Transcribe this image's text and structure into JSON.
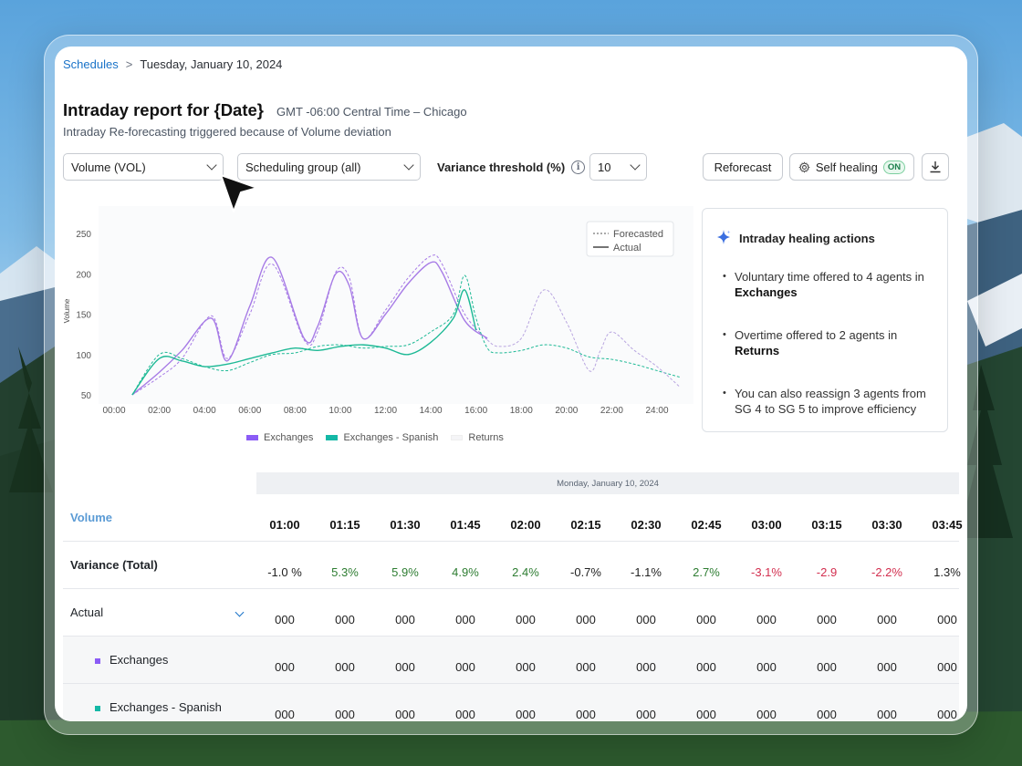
{
  "breadcrumb": {
    "link": "Schedules",
    "separator": ">",
    "current": "Tuesday, January 10, 2024"
  },
  "header": {
    "title": "Intraday report for {Date}",
    "timezone": "GMT -06:00 Central Time – Chicago",
    "subtitle": "Intraday Re-forecasting triggered because of Volume deviation"
  },
  "controls": {
    "metric_select": "Volume (VOL)",
    "group_select": "Scheduling group (all)",
    "variance_label": "Variance threshold (%)",
    "variance_value": "10",
    "reforecast_label": "Reforecast",
    "self_healing_label": "Self healing",
    "self_healing_state": "ON"
  },
  "chart_data": {
    "type": "line",
    "ylabel": "Volume",
    "ylim": [
      50,
      250
    ],
    "yticks": [
      "250",
      "200",
      "150",
      "100",
      "50"
    ],
    "xticks": [
      "00:00",
      "02:00",
      "04:00",
      "06:00",
      "08:00",
      "10:00",
      "12:00",
      "14:00",
      "16:00",
      "18:00",
      "20:00",
      "22:00",
      "24:00"
    ],
    "inner_legend": {
      "forecasted": "Forecasted",
      "actual": "Actual"
    },
    "series": [
      {
        "name": "Exchanges",
        "color": "#a77be6",
        "forecast_x": [
          0.8,
          2,
          3,
          4.3,
          5,
          6,
          7,
          8.4,
          9,
          9.8,
          10.4,
          11,
          12,
          13,
          14,
          14.5,
          15.5,
          16.5
        ],
        "forecast_y": [
          50,
          72,
          95,
          148,
          95,
          150,
          212,
          118,
          128,
          202,
          195,
          120,
          155,
          195,
          222,
          212,
          150,
          118
        ],
        "actual_x": [
          0.8,
          2,
          3,
          4.3,
          5,
          6,
          7,
          8.4,
          9,
          9.8,
          10.4,
          11,
          12,
          13,
          14,
          14.5,
          15.5,
          16.5
        ],
        "actual_y": [
          50,
          78,
          105,
          145,
          92,
          160,
          220,
          120,
          135,
          200,
          185,
          120,
          150,
          188,
          214,
          202,
          142,
          120
        ]
      },
      {
        "name": "Exchanges - Spanish",
        "color": "#1db995",
        "forecast_x": [
          0.8,
          2,
          3,
          4,
          5,
          6,
          7,
          8,
          9,
          10,
          11,
          12,
          13,
          14,
          15,
          15.5,
          16,
          16.5,
          17,
          18,
          19,
          20,
          21,
          22,
          23,
          24,
          25
        ],
        "forecast_y": [
          50,
          100,
          95,
          85,
          80,
          90,
          100,
          102,
          110,
          112,
          108,
          110,
          112,
          128,
          150,
          198,
          145,
          108,
          102,
          105,
          112,
          108,
          97,
          94,
          88,
          80,
          72
        ],
        "actual_x": [
          0.8,
          2,
          3,
          4,
          5,
          6,
          7,
          8,
          9,
          10,
          11,
          12,
          13,
          14,
          15,
          15.5,
          16
        ],
        "actual_y": [
          50,
          95,
          92,
          85,
          88,
          95,
          102,
          108,
          105,
          110,
          112,
          108,
          100,
          115,
          145,
          180,
          130
        ]
      },
      {
        "name": "Returns",
        "color": "#b9a6e0",
        "forecast_x": [
          16.5,
          17,
          18,
          19,
          20,
          21,
          21.5,
          22,
          23,
          24,
          25
        ],
        "forecast_y": [
          118,
          110,
          120,
          180,
          140,
          80,
          105,
          128,
          105,
          85,
          60
        ],
        "actual_x": [],
        "actual_y": []
      }
    ]
  },
  "legend": [
    "Exchanges",
    "Exchanges - Spanish",
    "Returns"
  ],
  "healing_panel": {
    "title": "Intraday healing actions",
    "items": [
      {
        "text": "Voluntary time offered to 4 agents in ",
        "bold": "Exchanges"
      },
      {
        "text": "Overtime offered to 2 agents in ",
        "bold": "Returns"
      },
      {
        "text": "You can also reassign 3 agents from SG 4 to SG 5 to improve efficiency",
        "bold": ""
      }
    ]
  },
  "table": {
    "date": "Monday, January 10, 2024",
    "header_label": "Volume",
    "times": [
      "01:00",
      "01:15",
      "01:30",
      "01:45",
      "02:00",
      "02:15",
      "02:30",
      "02:45",
      "03:00",
      "03:15",
      "03:30",
      "03:45"
    ],
    "variance_label": "Variance (Total)",
    "variance": [
      {
        "v": "-1.0 %",
        "s": "neu"
      },
      {
        "v": "5.3%",
        "s": "pos"
      },
      {
        "v": "5.9%",
        "s": "pos"
      },
      {
        "v": "4.9%",
        "s": "pos"
      },
      {
        "v": "2.4%",
        "s": "pos"
      },
      {
        "v": "-0.7%",
        "s": "neu"
      },
      {
        "v": "-1.1%",
        "s": "neu"
      },
      {
        "v": "2.7%",
        "s": "pos"
      },
      {
        "v": "-3.1%",
        "s": "neg"
      },
      {
        "v": "-2.9",
        "s": "neg"
      },
      {
        "v": "-2.2%",
        "s": "neg"
      },
      {
        "v": "1.3%",
        "s": "neu"
      }
    ],
    "actual_label": "Actual",
    "actual": [
      "000",
      "000",
      "000",
      "000",
      "000",
      "000",
      "000",
      "000",
      "000",
      "000",
      "000",
      "000"
    ],
    "sub_rows": [
      {
        "label": "Exchanges",
        "color": "#8b5cf6",
        "values": [
          "000",
          "000",
          "000",
          "000",
          "000",
          "000",
          "000",
          "000",
          "000",
          "000",
          "000",
          "000"
        ]
      },
      {
        "label": "Exchanges - Spanish",
        "color": "#14b8a6",
        "values": [
          "000",
          "000",
          "000",
          "000",
          "000",
          "000",
          "000",
          "000",
          "000",
          "000",
          "000",
          "000"
        ]
      }
    ]
  }
}
